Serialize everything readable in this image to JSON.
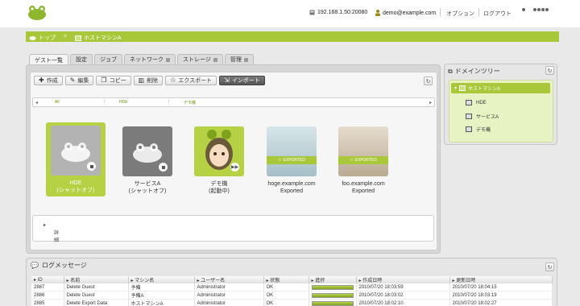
{
  "header": {
    "host": "192.168.1.50:20080",
    "user": "demo@example.com",
    "options": "オプション",
    "logout": "ログアウト"
  },
  "breadcrumb": {
    "home": "トップ",
    "current": "ホストマシンA"
  },
  "tabs": [
    {
      "label": "ゲスト一覧"
    },
    {
      "label": "設定"
    },
    {
      "label": "ジョブ"
    },
    {
      "label": "ネットワーク"
    },
    {
      "label": "ストレージ"
    },
    {
      "label": "管理"
    }
  ],
  "toolbar": {
    "create": "作成",
    "edit": "編集",
    "copy": "コピー",
    "delete": "削除",
    "export": "エクスポート",
    "import": "インポート"
  },
  "filter": [
    "All",
    "HDE",
    "デモ機"
  ],
  "vms": [
    {
      "name": "HDE",
      "status": "(シャットオフ)"
    },
    {
      "name": "サービスA",
      "status": "(シャットオフ)"
    },
    {
      "name": "デモ機",
      "status": "(起動中)"
    },
    {
      "name": "hoge.example.com",
      "status": "Exported",
      "badge": "EXPORTED"
    },
    {
      "name": "foo.example.com",
      "status": "Exported",
      "badge": "EXPORTED"
    }
  ],
  "detail_label": "詳細",
  "domain_tree": {
    "title": "ドメインツリー",
    "root": "ホストマシンA",
    "items": [
      "HDE",
      "サービスA",
      "デモ機"
    ]
  },
  "log": {
    "title": "ログメッセージ",
    "columns": [
      "ID",
      "名前",
      "マシン名",
      "ユーザー名",
      "状態",
      "進捗",
      "作成日時",
      "更新日時"
    ],
    "rows": [
      {
        "id": "2887",
        "name": "Delete Guest",
        "machine": "予備",
        "user": "Administrator",
        "state": "OK",
        "progress": 1.0,
        "created": "2010/07/20 18:03:59",
        "updated": "2010/07/20 18:04:15"
      },
      {
        "id": "2886",
        "name": "Delete Guest",
        "machine": "予備A",
        "user": "Administrator",
        "state": "OK",
        "progress": 1.0,
        "created": "2010/07/20 18:03:02",
        "updated": "2010/07/20 18:03:19"
      },
      {
        "id": "2885",
        "name": "Delete Export Data",
        "machine": "ホストマシンA",
        "user": "Administrator",
        "state": "OK",
        "progress": 1.0,
        "created": "2010/07/20 18:02:10",
        "updated": "2010/07/20 18:02:27"
      }
    ]
  },
  "colors": {
    "accent": "#a8c83a",
    "accent_dark": "#7fa21c"
  }
}
